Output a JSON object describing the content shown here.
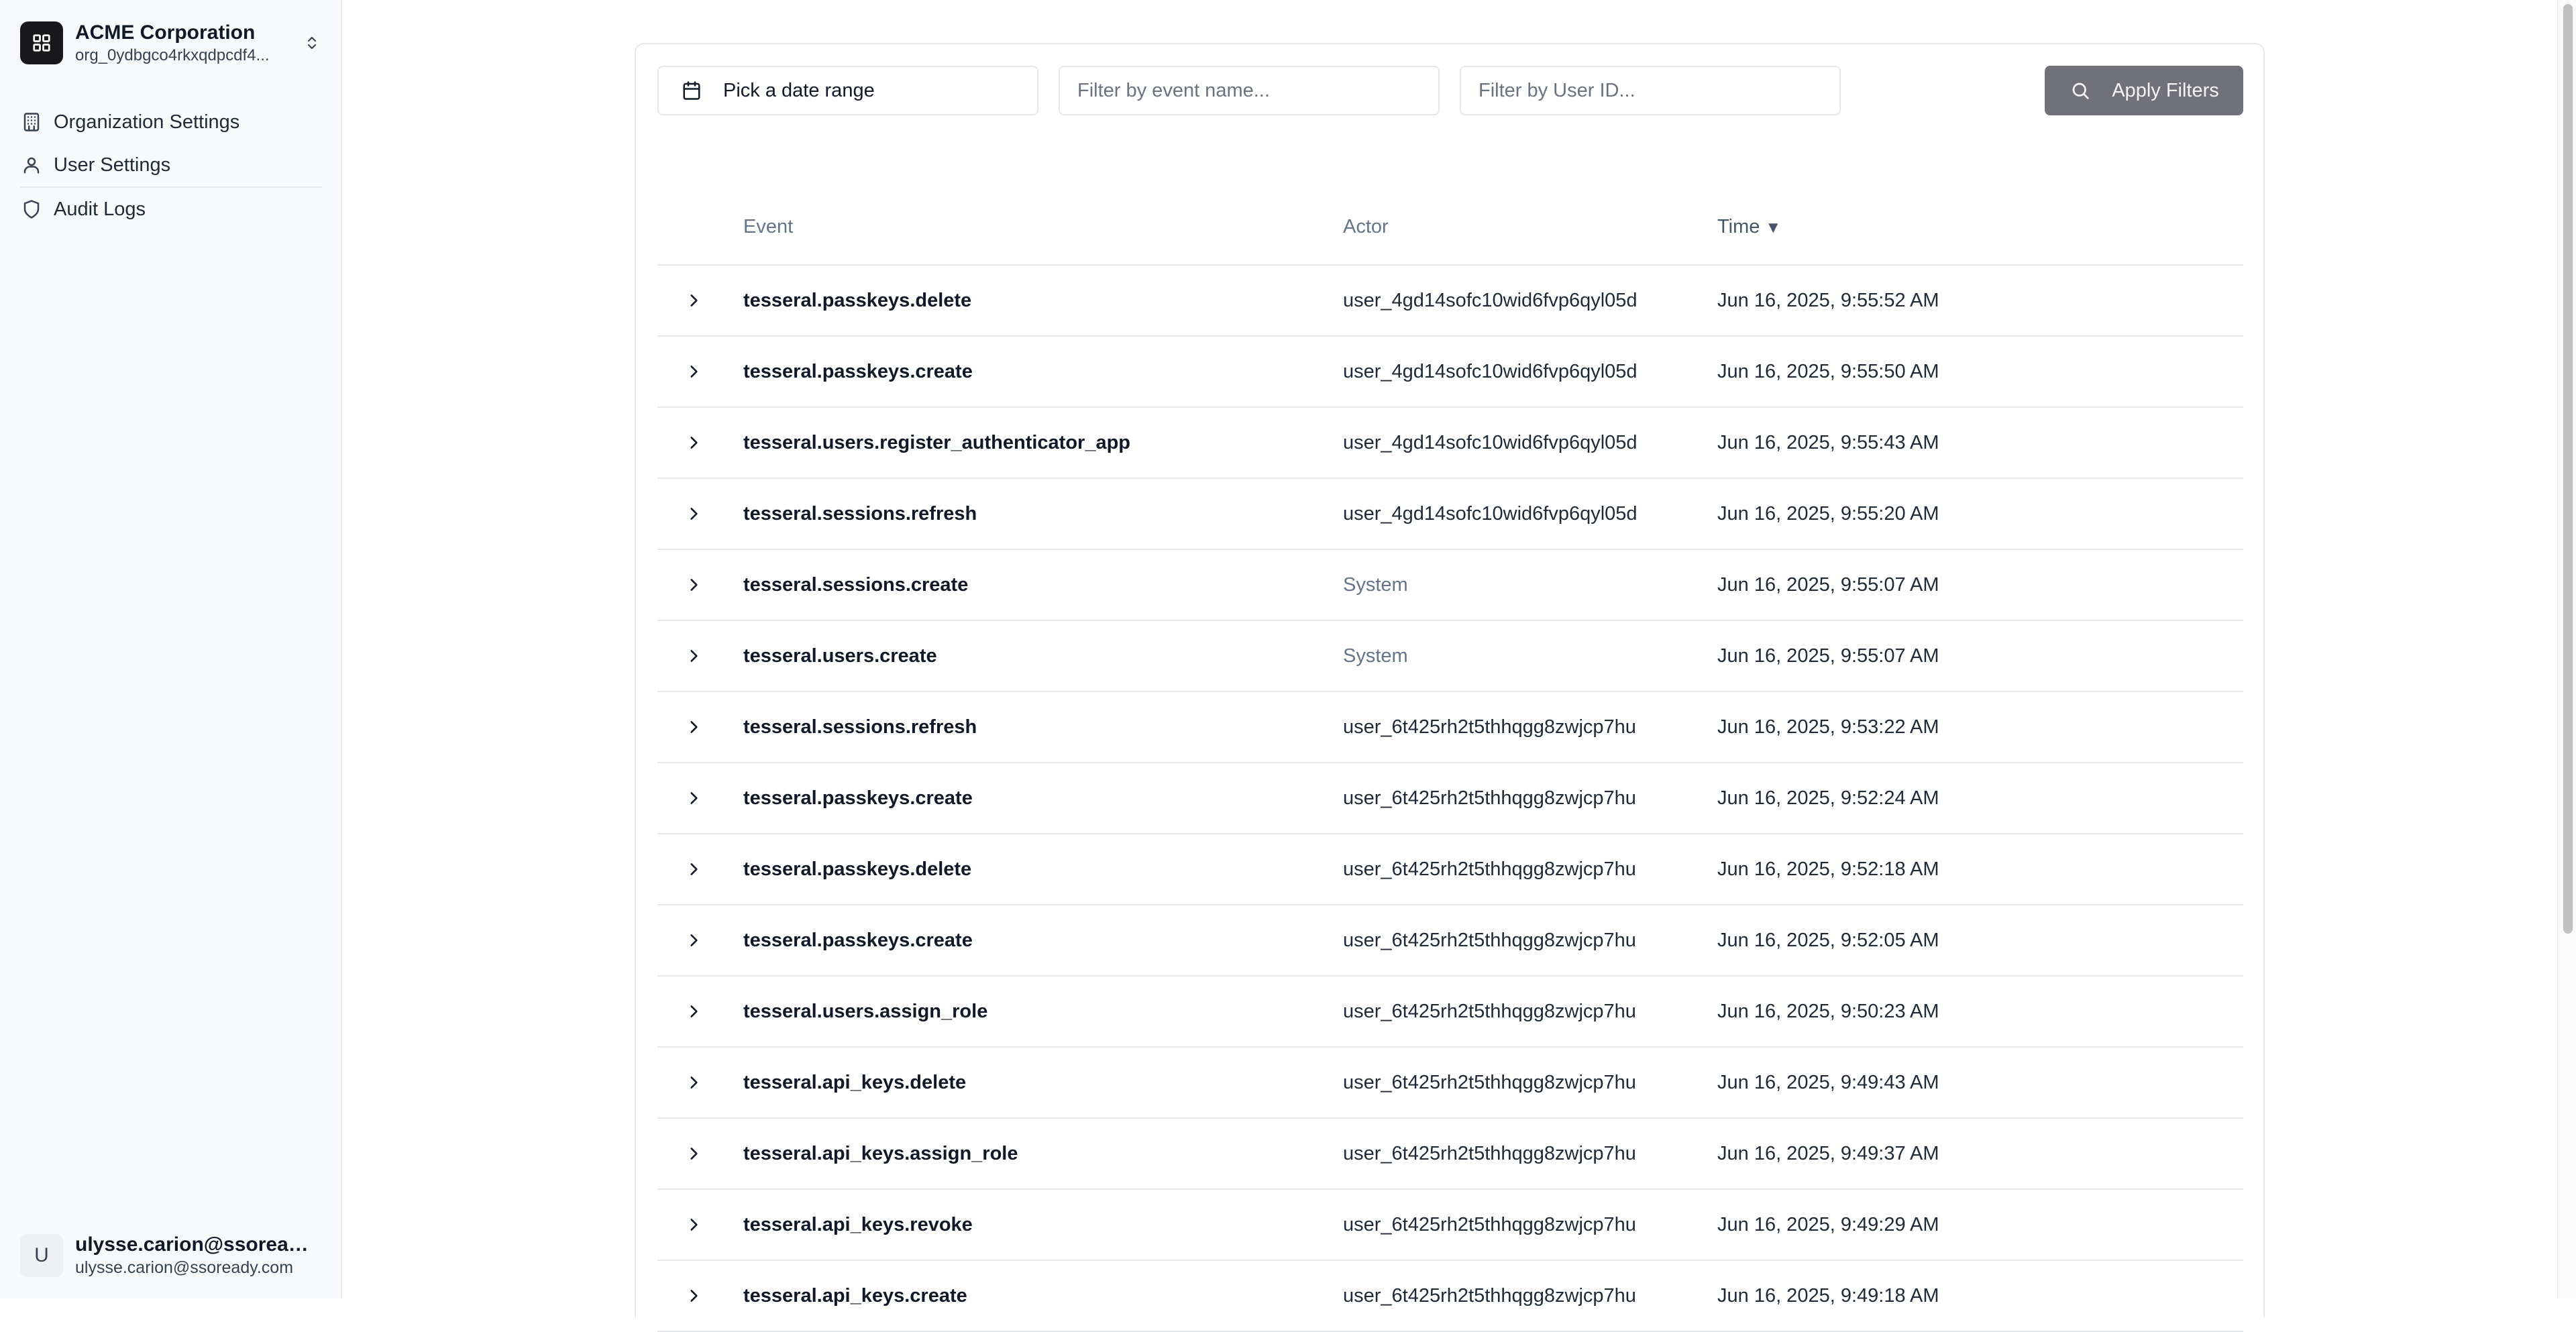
{
  "organization": {
    "name": "ACME Corporation",
    "id": "org_0ydbgco4rkxqdpcdf4..."
  },
  "sidebar": {
    "items": [
      {
        "label": "Organization Settings",
        "icon": "building-icon"
      },
      {
        "label": "User Settings",
        "icon": "user-icon"
      },
      {
        "label": "Audit Logs",
        "icon": "shield-icon"
      }
    ]
  },
  "current_user": {
    "avatar_initial": "U",
    "name": "ulysse.carion@ssoready...",
    "email": "ulysse.carion@ssoready.com"
  },
  "filters": {
    "date_range_label": "Pick a date range",
    "event_placeholder": "Filter by event name...",
    "user_placeholder": "Filter by User ID...",
    "apply_label": "Apply Filters"
  },
  "table": {
    "columns": {
      "event": "Event",
      "actor": "Actor",
      "time": "Time",
      "sort_indicator": "▼"
    },
    "rows": [
      {
        "event": "tesseral.passkeys.delete",
        "actor": "user_4gd14sofc10wid6fvp6qyl05d",
        "time": "Jun 16, 2025, 9:55:52 AM"
      },
      {
        "event": "tesseral.passkeys.create",
        "actor": "user_4gd14sofc10wid6fvp6qyl05d",
        "time": "Jun 16, 2025, 9:55:50 AM"
      },
      {
        "event": "tesseral.users.register_authenticator_app",
        "actor": "user_4gd14sofc10wid6fvp6qyl05d",
        "time": "Jun 16, 2025, 9:55:43 AM"
      },
      {
        "event": "tesseral.sessions.refresh",
        "actor": "user_4gd14sofc10wid6fvp6qyl05d",
        "time": "Jun 16, 2025, 9:55:20 AM"
      },
      {
        "event": "tesseral.sessions.create",
        "actor": "System",
        "time": "Jun 16, 2025, 9:55:07 AM"
      },
      {
        "event": "tesseral.users.create",
        "actor": "System",
        "time": "Jun 16, 2025, 9:55:07 AM"
      },
      {
        "event": "tesseral.sessions.refresh",
        "actor": "user_6t425rh2t5thhqgg8zwjcp7hu",
        "time": "Jun 16, 2025, 9:53:22 AM"
      },
      {
        "event": "tesseral.passkeys.create",
        "actor": "user_6t425rh2t5thhqgg8zwjcp7hu",
        "time": "Jun 16, 2025, 9:52:24 AM"
      },
      {
        "event": "tesseral.passkeys.delete",
        "actor": "user_6t425rh2t5thhqgg8zwjcp7hu",
        "time": "Jun 16, 2025, 9:52:18 AM"
      },
      {
        "event": "tesseral.passkeys.create",
        "actor": "user_6t425rh2t5thhqgg8zwjcp7hu",
        "time": "Jun 16, 2025, 9:52:05 AM"
      },
      {
        "event": "tesseral.users.assign_role",
        "actor": "user_6t425rh2t5thhqgg8zwjcp7hu",
        "time": "Jun 16, 2025, 9:50:23 AM"
      },
      {
        "event": "tesseral.api_keys.delete",
        "actor": "user_6t425rh2t5thhqgg8zwjcp7hu",
        "time": "Jun 16, 2025, 9:49:43 AM"
      },
      {
        "event": "tesseral.api_keys.assign_role",
        "actor": "user_6t425rh2t5thhqgg8zwjcp7hu",
        "time": "Jun 16, 2025, 9:49:37 AM"
      },
      {
        "event": "tesseral.api_keys.revoke",
        "actor": "user_6t425rh2t5thhqgg8zwjcp7hu",
        "time": "Jun 16, 2025, 9:49:29 AM"
      },
      {
        "event": "tesseral.api_keys.create",
        "actor": "user_6t425rh2t5thhqgg8zwjcp7hu",
        "time": "Jun 16, 2025, 9:49:18 AM"
      }
    ]
  },
  "colors": {
    "apply_button": "#71717a",
    "org_logo_bg": "#18181b",
    "muted_text": "#64748b",
    "border": "#e5e7eb"
  }
}
